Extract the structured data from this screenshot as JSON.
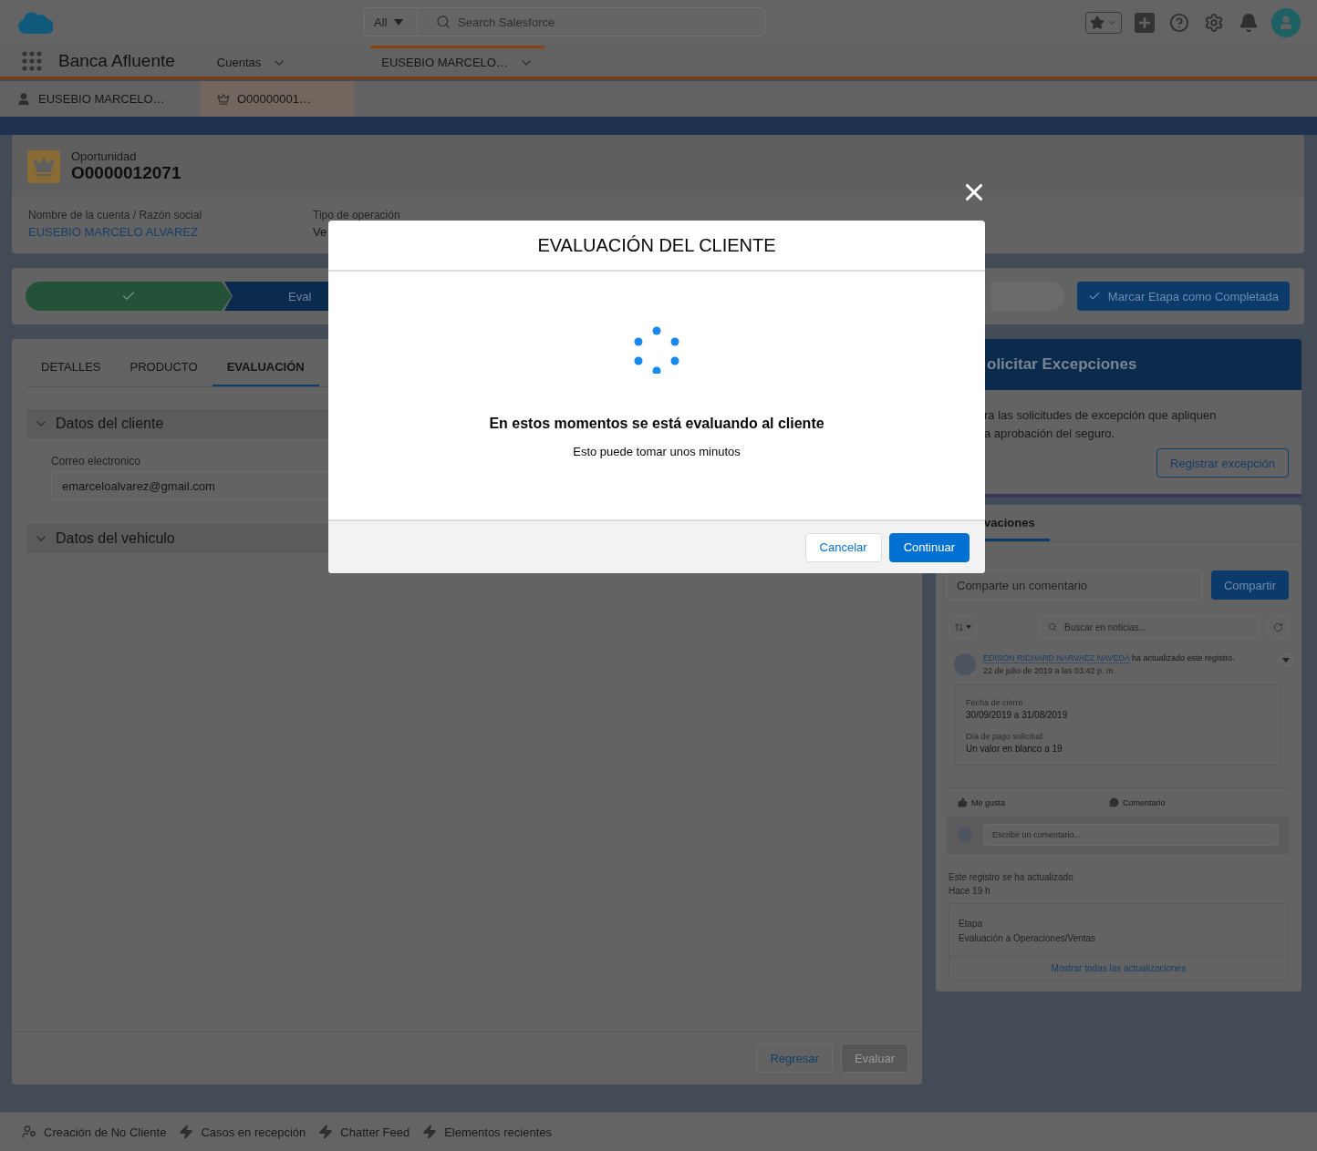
{
  "header": {
    "search_scope": "All",
    "search_placeholder": "Search Salesforce"
  },
  "nav": {
    "app_name": "Banca Afluente",
    "items": [
      {
        "label": "Cuentas",
        "selected": false
      },
      {
        "label": "EUSEBIO MARCELO…",
        "selected": true
      }
    ]
  },
  "subtabs": [
    {
      "label": "EUSEBIO MARCELO…",
      "kind": "account",
      "selected": false
    },
    {
      "label": "O00000001…",
      "kind": "opportunity",
      "selected": true
    }
  ],
  "record": {
    "type": "Oportunidad",
    "name": "O0000012071",
    "fields": [
      {
        "label": "Nombre de la cuenta / Razón social",
        "value": "EUSEBIO MARCELO ALVAREZ",
        "kind": "link"
      },
      {
        "label": "Tipo de operación",
        "value": "Ve",
        "kind": "text"
      }
    ]
  },
  "path": {
    "steps": [
      {
        "kind": "complete"
      },
      {
        "kind": "current",
        "label": "Eval"
      },
      {
        "kind": "upcoming"
      }
    ],
    "complete_button": "Marcar Etapa como Completada"
  },
  "tabs": [
    {
      "label": "DETALLES",
      "selected": false
    },
    {
      "label": "PRODUCTO",
      "selected": false
    },
    {
      "label": "EVALUACIÓN",
      "selected": true
    }
  ],
  "sections": [
    {
      "title": "Datos del cliente",
      "expanded": true,
      "fields": [
        {
          "label": "Correo electronico",
          "value": "emarceloalvarez@gmail.com"
        }
      ]
    },
    {
      "title": "Datos del vehiculo",
      "expanded": true
    }
  ],
  "footer_buttons": [
    {
      "label": "Regresar",
      "disabled": false
    },
    {
      "label": "Evaluar",
      "disabled": true
    }
  ],
  "exceptions": {
    "title": "olicitar Excepciones",
    "lines": [
      "ra las solicitudes de excepción que apliquen",
      "a aprobación del seguro."
    ],
    "button": "Registrar excepción"
  },
  "feed": {
    "tabs": [
      {
        "label": "vaciones",
        "selected": true
      }
    ],
    "comment_placeholder": "Comparte un comentario",
    "share_button": "Compartir",
    "search_placeholder": "Buscar en noticias...",
    "post": {
      "author": "EDISON RICHARD NARVAEZ NAVEDA",
      "action": "ha actualizado este registro.",
      "date": "22 de julio de 2019 a las 03:42 p. m.",
      "changes": [
        {
          "label": "Fecha de cierre",
          "value": "30/09/2019 a 31/08/2019"
        },
        {
          "label": "Día de pago solicitud",
          "value": "Un valor en blanco a 19"
        }
      ],
      "like": "Me gusta",
      "comment": "Comentario",
      "reply_placeholder": "Escribir un comentario..."
    },
    "update": {
      "title": "Este registro se ha actualizado",
      "time": "Hace 19 h",
      "label": "Etapa",
      "value": "Evaluación a Operaciones/Ventas",
      "link": "Mostrar todas las actualizaciones"
    }
  },
  "utility_bar": [
    {
      "label": "Creación de No Cliente",
      "kind": "person"
    },
    {
      "label": "Casos en recepción",
      "kind": "bolt"
    },
    {
      "label": "Chatter Feed",
      "kind": "bolt"
    },
    {
      "label": "Elementos recientes",
      "kind": "bolt"
    }
  ],
  "modal": {
    "title": "EVALUACIÓN DEL CLIENTE",
    "message": "En estos momentos se está evaluando al cliente",
    "note": "Esto puede tomar unos minutos",
    "buttons": [
      {
        "label": "Cancelar",
        "kind": "neutral"
      },
      {
        "label": "Continuar",
        "kind": "brand"
      }
    ]
  }
}
